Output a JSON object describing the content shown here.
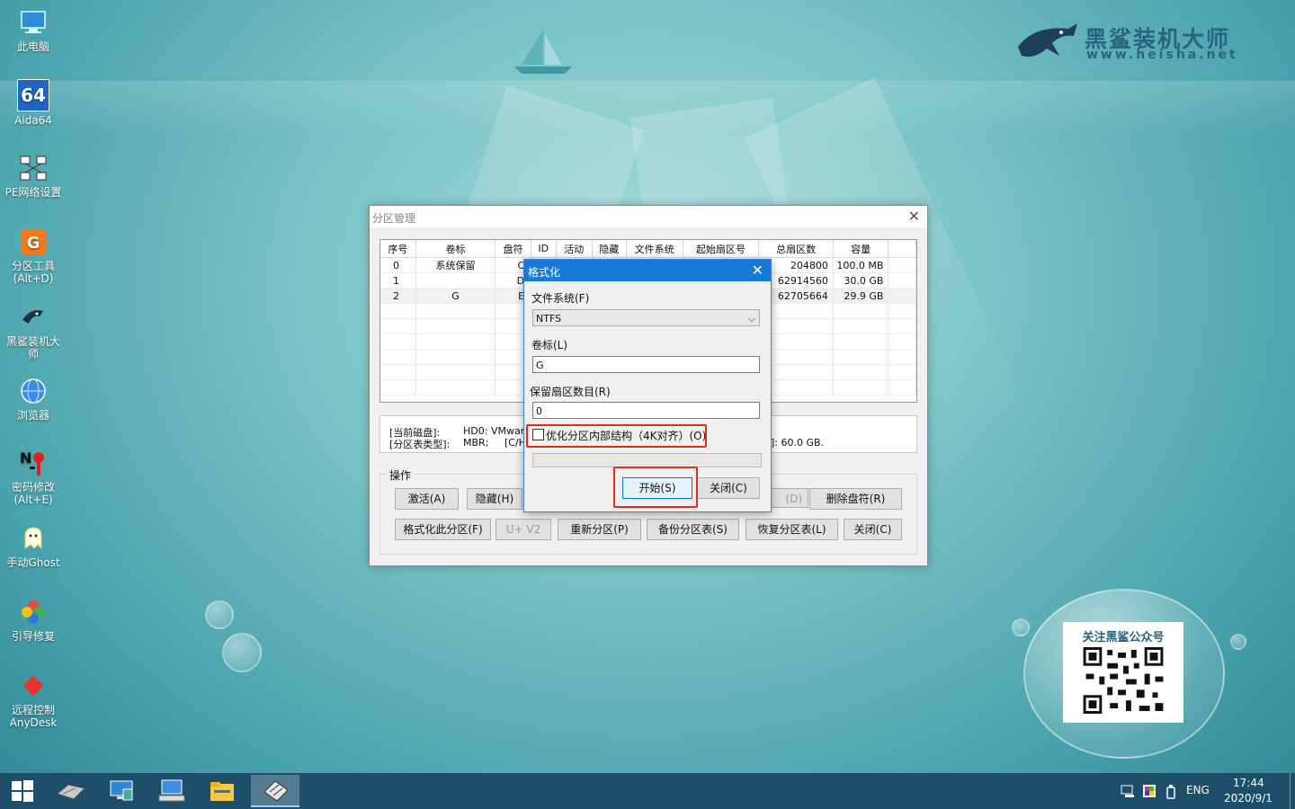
{
  "desktop": {
    "icons": [
      {
        "label": "此电脑"
      },
      {
        "label": "Aida64",
        "badge": "64"
      },
      {
        "label": "PE网络设置"
      },
      {
        "label": "分区工具\n(Alt+D)"
      },
      {
        "label": "黑鲨装机大\n师"
      },
      {
        "label": "浏览器"
      },
      {
        "label": "密码修改\n(Alt+E)"
      },
      {
        "label": "手动Ghost"
      },
      {
        "label": "引导修复"
      },
      {
        "label": "远程控制\nAnyDesk"
      }
    ],
    "logo": {
      "name": "黑鲨装机大师",
      "url": "www.heisha.net"
    },
    "qr_caption": "关注黑鲨公众号"
  },
  "partition_window": {
    "title": "分区管理",
    "columns": [
      "序号",
      "卷标",
      "盘符",
      "ID",
      "活动",
      "隐藏",
      "文件系统",
      "起始扇区号",
      "总扇区数",
      "容量"
    ],
    "rows": [
      {
        "index": "0",
        "label": "系统保留",
        "drive": "C:",
        "total": "204800",
        "size": "100.0 MB"
      },
      {
        "index": "1",
        "label": "",
        "drive": "D:",
        "total": "62914560",
        "size": "30.0 GB"
      },
      {
        "index": "2",
        "label": "G",
        "drive": "E:",
        "total": "62705664",
        "size": "29.9 GB"
      }
    ],
    "disk_info": {
      "current_disk_label": "[当前磁盘]:",
      "current_disk_value": "HD0: VMware,",
      "table_type_label": "[分区表类型]:",
      "table_type_value": "MBR;",
      "chs_partial": "[C/H",
      "size_partial": "]: 60.0 GB."
    },
    "ops_label": "操作",
    "buttons": {
      "activate": "激活(A)",
      "hide": "隐藏(H)",
      "hidden_partial": "(D)",
      "delete_letter": "删除盘符(R)",
      "format_partition": "格式化此分区(F)",
      "uv2": "U+ V2",
      "repartition": "重新分区(P)",
      "backup_table": "备份分区表(S)",
      "restore_table": "恢复分区表(L)",
      "close": "关闭(C)"
    }
  },
  "format_dialog": {
    "title": "格式化",
    "fs_label": "文件系统(F)",
    "fs_value": "NTFS",
    "volume_label": "卷标(L)",
    "volume_value": "G",
    "reserved_label": "保留扇区数目(R)",
    "reserved_value": "0",
    "optimize_label": "优化分区内部结构（4K对齐）(O)",
    "start_button": "开始(S)",
    "close_button": "关闭(C)"
  },
  "taskbar": {
    "lang": "ENG",
    "time": "17:44",
    "date": "2020/9/1"
  },
  "colors": {
    "highlight": "#e52a22",
    "dialog_title": "#1979d6",
    "taskbar": "#1d4f6b"
  }
}
